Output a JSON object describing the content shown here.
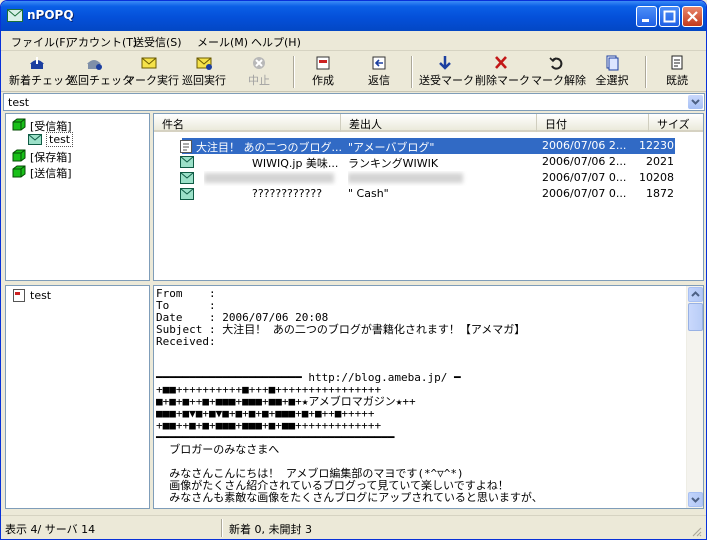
{
  "window": {
    "title": "nPOPQ"
  },
  "menu": [
    "ファイル(F)",
    "アカウント(T)",
    "送受信(S)",
    "メール(M)",
    "ヘルプ(H)"
  ],
  "toolbar": {
    "new_check": "新着チェック",
    "round_check": "巡回チェック",
    "mark_exec": "マーク実行",
    "round_exec": "巡回実行",
    "stop": "中止",
    "compose": "作成",
    "reply": "返信",
    "send_mark": "送受マーク",
    "delete_mark": "削除マーク",
    "unmark": "マーク解除",
    "select_all": "全選択",
    "read": "既読"
  },
  "account_combo": {
    "value": "test"
  },
  "folders": [
    {
      "label": "[受信箱]"
    },
    {
      "label": "test"
    },
    {
      "label": "[保存箱]"
    },
    {
      "label": "[送信箱]"
    }
  ],
  "lower_tree": {
    "item": "test"
  },
  "list": {
    "columns": [
      "件名",
      "差出人",
      "日付",
      "サイズ"
    ],
    "rows": [
      {
        "subject": "大注目！ あの二つのブログ...",
        "from": "\"アメーバブログ\"",
        "date": "2006/07/06 2...",
        "size": "12230"
      },
      {
        "subject": "WIWIQ.jp  美味...",
        "from": "ランキングWIWIK",
        "date": "2006/07/06 2...",
        "size": "2021"
      },
      {
        "subject": "",
        "from": "",
        "date": "2006/07/07 0...",
        "size": "10208"
      },
      {
        "subject": "????????????",
        "from": "\" Cash\"",
        "date": "2006/07/07 0...",
        "size": "1872"
      }
    ]
  },
  "message": {
    "lines": [
      "From    :",
      "To      :",
      "Date    : 2006/07/06 20:08",
      "Subject : 大注目！ あの二つのブログが書籍化されます！【アメマガ】",
      "Received:",
      "",
      "",
      "━━━━━━━━━━━━━━━━━━━━━━ http://blog.ameba.jp/ ━",
      "+■■++++++++++■+++■++++++++++++++++",
      "■+■+■++■+■■■+■■■+■■+■+★アメブロマガジン★++",
      "■■■+■▼■+■▼■+■+■+■+■■■+■+■++■+++++",
      "+■■++■+■+■■■+■■■+■+■■+++++++++++++",
      "━━━━━━━━━━━━━━━━━━━━━━━━━━━━━━━━━━━━",
      "  ブロガーのみなさまへ",
      "",
      "  みなさんこんにちは！ アメブロ編集部のマヨです(*^▽^*)",
      "  画像がたくさん紹介されているブログって見ていて楽しいですよね！",
      "  みなさんも素敵な画像をたくさんブログにアップされていると思いますが、"
    ]
  },
  "status": {
    "left": "表示 4/ サーバ 14",
    "right": "新着 0, 未開封 3"
  }
}
